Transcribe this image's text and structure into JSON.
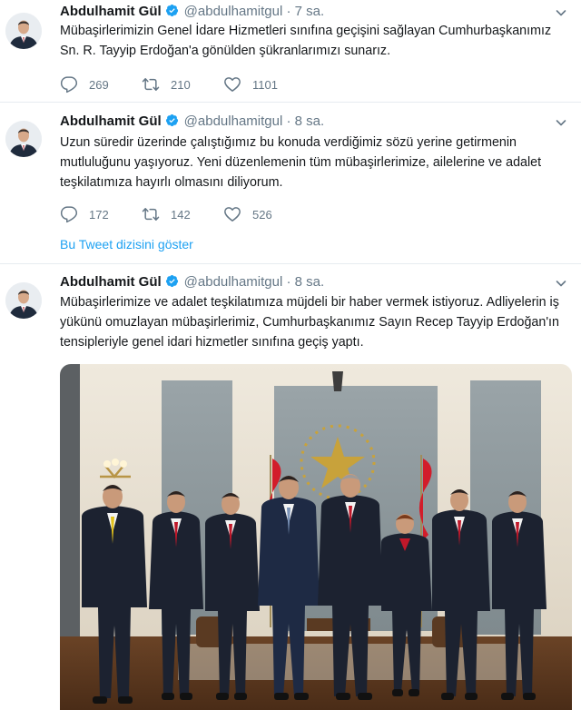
{
  "colors": {
    "link": "#1da1f2",
    "secondary": "#657786",
    "verified": "#1da1f2",
    "divider": "#e6ecf0"
  },
  "tweets": [
    {
      "name": "Abdulhamit Gül",
      "handle": "@abdulhamitgul",
      "dot": "·",
      "time": "7 sa.",
      "text": "Mübaşirlerimizin Genel İdare Hizmetleri sınıfına geçişini sağlayan Cumhurbaşkanımız Sn. R. Tayyip Erdoğan'a gönülden şükranlarımızı sunarız.",
      "replies": "269",
      "retweets": "210",
      "likes": "1101"
    },
    {
      "name": "Abdulhamit Gül",
      "handle": "@abdulhamitgul",
      "dot": "·",
      "time": "8 sa.",
      "text": "Uzun süredir üzerinde çalıştığımız bu konuda verdiğimiz sözü yerine getirmenin mutluluğunu yaşıyoruz. Yeni düzenlemenin tüm mübaşirlerimize, ailelerine ve adalet teşkilatımıza hayırlı olmasını diliyorum.",
      "replies": "172",
      "retweets": "142",
      "likes": "526",
      "thread_link": "Bu Tweet dizisini göster"
    },
    {
      "name": "Abdulhamit Gül",
      "handle": "@abdulhamitgul",
      "dot": "·",
      "time": "8 sa.",
      "text": "Mübaşirlerimize ve adalet teşkilatımıza müjdeli bir haber vermek istiyoruz. Adliyelerin iş yükünü omuzlayan mübaşirlerimiz, Cumhurbaşkanımız Sayın Recep Tayyip Erdoğan'ın tensipleriyle genel idari hizmetler sınıfına geçiş yaptı."
    }
  ]
}
